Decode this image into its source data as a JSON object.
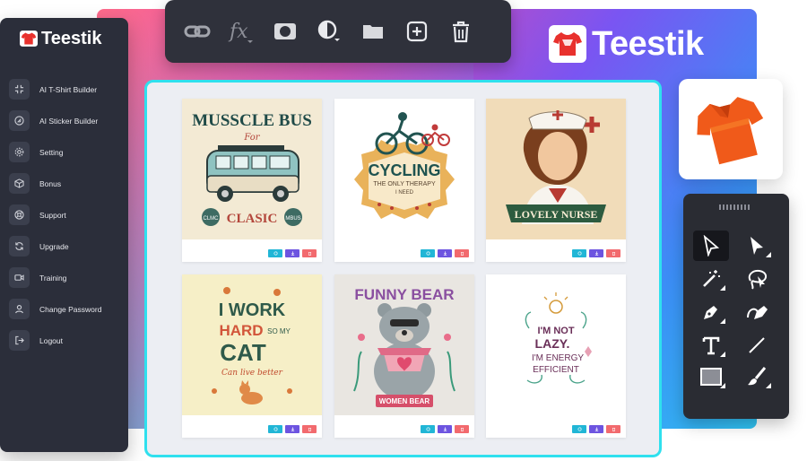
{
  "brand": {
    "name": "Teestik"
  },
  "sidebar": {
    "logo_text": "Teestik",
    "items": [
      {
        "label": "AI T-Shirt Builder",
        "icon": "shrink-arrows-icon"
      },
      {
        "label": "AI Sticker Builder",
        "icon": "sticker-icon"
      },
      {
        "label": "Setting",
        "icon": "gear-icon"
      },
      {
        "label": "Bonus",
        "icon": "box-icon"
      },
      {
        "label": "Support",
        "icon": "lifebuoy-icon"
      },
      {
        "label": "Upgrade",
        "icon": "refresh-icon"
      },
      {
        "label": "Training",
        "icon": "video-icon"
      },
      {
        "label": "Change Password",
        "icon": "user-icon"
      },
      {
        "label": "Logout",
        "icon": "logout-icon"
      }
    ]
  },
  "toolbar": {
    "tools": [
      "link-icon",
      "fx-icon",
      "mask-icon",
      "contrast-icon",
      "folder-icon",
      "add-icon",
      "trash-icon"
    ]
  },
  "gallery": {
    "cards": [
      {
        "line1": "MUSSCLE BUS",
        "line2": "For",
        "line3": "CLASIC",
        "badge_left": "CLMC",
        "badge_right": "MBUS"
      },
      {
        "line1": "CYCLING",
        "line2": "THE ONLY THERAPY",
        "line3": "I NEED"
      },
      {
        "line1": "LOVELY NURSE"
      },
      {
        "line1": "I WORK",
        "line2": "HARD",
        "line3": "SO MY",
        "line4": "CAT",
        "line5": "Can live better"
      },
      {
        "line1": "FUNNY BEAR",
        "line2": "WOMEN BEAR"
      },
      {
        "line1": "I'M NOT",
        "line2": "LAZY.",
        "line3": "I'M ENERGY",
        "line4": "EFFICIENT"
      }
    ],
    "actions": [
      "refresh-icon",
      "download-icon",
      "delete-icon"
    ]
  },
  "palette": {
    "tools": [
      "select-arrow-icon",
      "direct-select-icon",
      "magic-wand-icon",
      "lasso-icon",
      "pen-icon",
      "curvature-pen-icon",
      "text-tool-icon",
      "line-tool-icon",
      "rectangle-tool-icon",
      "brush-icon"
    ]
  },
  "colors": {
    "gallery_border": "#2fe0ee",
    "sidebar_bg": "#2b2e3a",
    "toolbar_bg": "#2f313b",
    "action_refresh": "#21b6d6",
    "action_download": "#6d54e0",
    "action_delete": "#f26a6e"
  }
}
